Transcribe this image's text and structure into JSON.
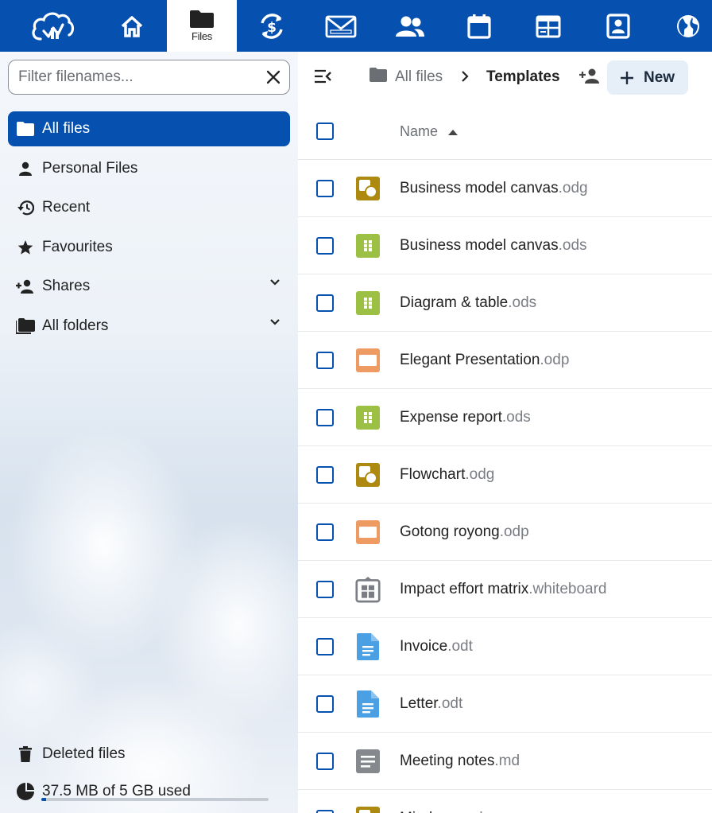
{
  "app": {
    "top_nav": [
      {
        "icon": "cloud-logo-icon"
      },
      {
        "icon": "home-icon"
      },
      {
        "icon": "folder-icon",
        "label": "Files",
        "active": true
      },
      {
        "icon": "currency-sync-icon"
      },
      {
        "icon": "mail-icon"
      },
      {
        "icon": "contacts-icon"
      },
      {
        "icon": "calendar-icon"
      },
      {
        "icon": "board-icon"
      },
      {
        "icon": "profile-card-icon"
      },
      {
        "icon": "globe-icon"
      }
    ],
    "brand_color": "#0651b0"
  },
  "sidebar": {
    "filter_placeholder": "Filter filenames...",
    "items": [
      {
        "label": "All files",
        "icon": "folder-icon",
        "active": true
      },
      {
        "label": "Personal Files",
        "icon": "person-icon"
      },
      {
        "label": "Recent",
        "icon": "history-icon"
      },
      {
        "label": "Favourites",
        "icon": "star-icon"
      },
      {
        "label": "Shares",
        "icon": "share-person-icon",
        "expandable": true
      },
      {
        "label": "All folders",
        "icon": "folders-icon",
        "expandable": true
      }
    ],
    "deleted_label": "Deleted files",
    "quota_label": "37.5 MB of 5 GB used",
    "quota_fraction": 0.0075
  },
  "main": {
    "breadcrumb_root": "All files",
    "breadcrumb_current": "Templates",
    "new_label": "New",
    "name_header": "Name",
    "files": [
      {
        "name": "Business model canvas",
        "ext": ".odg",
        "icon": "drawing-icon"
      },
      {
        "name": "Business model canvas",
        "ext": ".ods",
        "icon": "spreadsheet-icon"
      },
      {
        "name": "Diagram & table",
        "ext": ".ods",
        "icon": "spreadsheet-icon"
      },
      {
        "name": "Elegant Presentation",
        "ext": ".odp",
        "icon": "presentation-icon"
      },
      {
        "name": "Expense report",
        "ext": ".ods",
        "icon": "spreadsheet-icon"
      },
      {
        "name": "Flowchart",
        "ext": ".odg",
        "icon": "drawing-icon"
      },
      {
        "name": "Gotong royong",
        "ext": ".odp",
        "icon": "presentation-icon"
      },
      {
        "name": "Impact effort matrix",
        "ext": ".whiteboard",
        "icon": "whiteboard-icon"
      },
      {
        "name": "Invoice",
        "ext": ".odt",
        "icon": "document-icon"
      },
      {
        "name": "Letter",
        "ext": ".odt",
        "icon": "document-icon"
      },
      {
        "name": "Meeting notes",
        "ext": ".md",
        "icon": "text-icon"
      },
      {
        "name": "Mindmap",
        "ext": ".odg",
        "icon": "drawing-icon"
      }
    ]
  }
}
